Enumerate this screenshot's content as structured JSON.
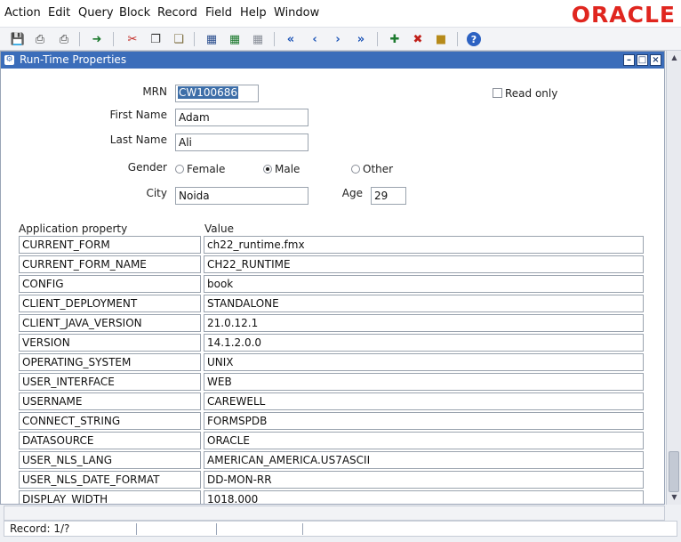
{
  "menubar": {
    "items": [
      "Action",
      "Edit",
      "Query",
      "Block",
      "Record",
      "Field",
      "Help",
      "Window"
    ],
    "logo": "ORACLE"
  },
  "toolbar": {
    "icons": [
      "save-icon",
      "print-icon",
      "print-setup-icon",
      "exit-icon",
      "cut-icon",
      "copy-icon",
      "paste-icon",
      "enter-query-icon",
      "execute-query-icon",
      "cancel-query-icon",
      "first-record-icon",
      "previous-record-icon",
      "next-record-icon",
      "last-record-icon",
      "insert-record-icon",
      "delete-record-icon",
      "lock-record-icon",
      "help-icon"
    ]
  },
  "window": {
    "title": "Run-Time Properties"
  },
  "form": {
    "mrn_label": "MRN",
    "mrn_value": "CW100686",
    "first_name_label": "First Name",
    "first_name_value": "Adam",
    "last_name_label": "Last Name",
    "last_name_value": "Ali",
    "gender_label": "Gender",
    "gender_options": [
      "Female",
      "Male",
      "Other"
    ],
    "gender_selected": "Male",
    "city_label": "City",
    "city_value": "Noida",
    "age_label": "Age",
    "age_value": "29",
    "read_only_label": "Read only",
    "read_only_checked": false
  },
  "table": {
    "headers": [
      "Application property",
      "Value"
    ],
    "rows": [
      {
        "property": "CURRENT_FORM",
        "value": "ch22_runtime.fmx"
      },
      {
        "property": "CURRENT_FORM_NAME",
        "value": "CH22_RUNTIME"
      },
      {
        "property": "CONFIG",
        "value": "book"
      },
      {
        "property": "CLIENT_DEPLOYMENT",
        "value": "STANDALONE"
      },
      {
        "property": "CLIENT_JAVA_VERSION",
        "value": "21.0.12.1"
      },
      {
        "property": "VERSION",
        "value": "14.1.2.0.0"
      },
      {
        "property": "OPERATING_SYSTEM",
        "value": "UNIX"
      },
      {
        "property": "USER_INTERFACE",
        "value": "WEB"
      },
      {
        "property": "USERNAME",
        "value": "CAREWELL"
      },
      {
        "property": "CONNECT_STRING",
        "value": "FORMSPDB"
      },
      {
        "property": "DATASOURCE",
        "value": "ORACLE"
      },
      {
        "property": "USER_NLS_LANG",
        "value": "AMERICAN_AMERICA.US7ASCII"
      },
      {
        "property": "USER_NLS_DATE_FORMAT",
        "value": "DD-MON-RR"
      },
      {
        "property": "DISPLAY_WIDTH",
        "value": "1018.000"
      }
    ]
  },
  "status": {
    "record": "Record: 1/?"
  },
  "colors": {
    "titlebar": "#3b6dba",
    "logo": "#e0261f",
    "selection": "#3d6ea8"
  }
}
